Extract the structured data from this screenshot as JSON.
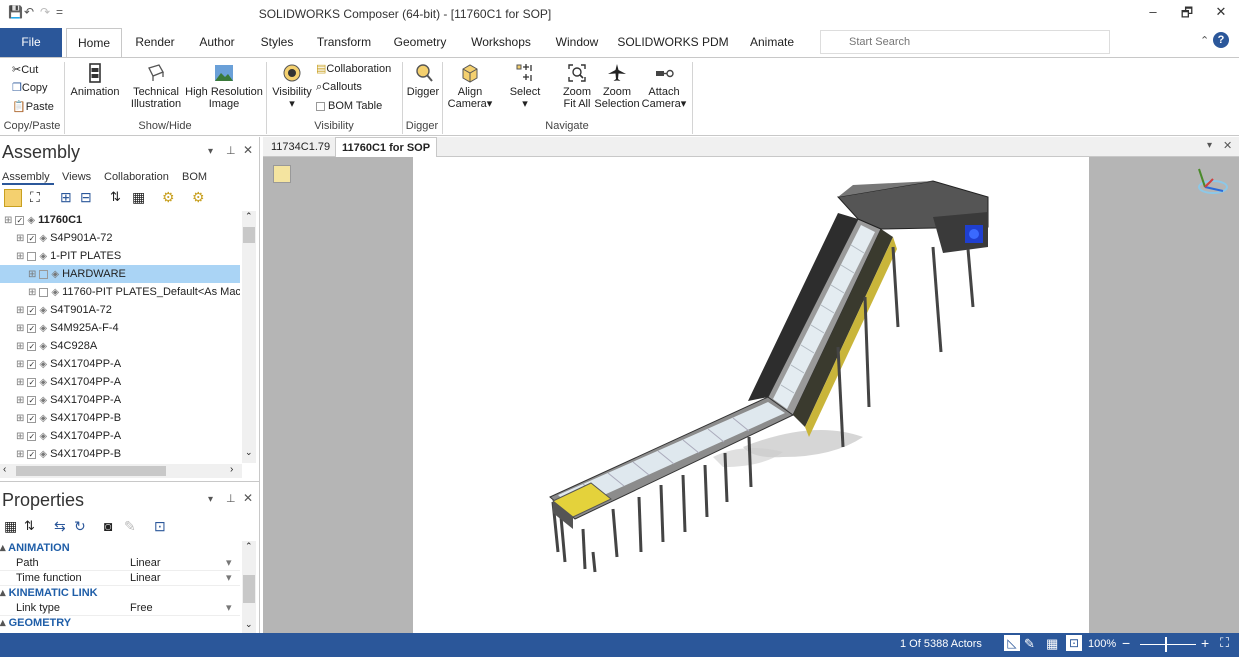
{
  "window": {
    "title": "SOLIDWORKS Composer (64-bit) - [11760C1 for SOP]",
    "controls": {
      "minimize": "–",
      "restore": "🗗",
      "close": "✕"
    }
  },
  "quick_access": {
    "save": "💾",
    "undo": "↶",
    "redo": "↷",
    "customize": "="
  },
  "tabs": {
    "file": "File",
    "items": [
      "Home",
      "Render",
      "Author",
      "Styles",
      "Transform",
      "Geometry",
      "Workshops",
      "Window",
      "SOLIDWORKS PDM",
      "Animate"
    ],
    "active": "Home"
  },
  "search": {
    "placeholder": "Start Search"
  },
  "ribbon": {
    "clipboard": {
      "cut": "Cut",
      "copy": "Copy",
      "paste": "Paste",
      "group": "Copy/Paste"
    },
    "showhide": {
      "animation": "Animation",
      "technical1": "Technical",
      "technical2": "Illustration",
      "hires1": "High Resolution",
      "hires2": "Image",
      "group": "Show/Hide"
    },
    "visibility": {
      "visibility": "Visibility",
      "collaboration": "Collaboration",
      "callouts": "Callouts",
      "bom_table": "BOM Table",
      "group": "Visibility"
    },
    "digger": {
      "digger": "Digger",
      "group": "Digger"
    },
    "navigate": {
      "align1": "Align",
      "align2": "Camera▾",
      "select": "Select",
      "zoomfit1": "Zoom",
      "zoomfit2": "Fit All",
      "zoomsel1": "Zoom",
      "zoomsel2": "Selection",
      "attach1": "Attach",
      "attach2": "Camera▾",
      "group": "Navigate"
    }
  },
  "assembly_panel": {
    "title": "Assembly",
    "subtabs": [
      "Assembly",
      "Views",
      "Collaboration",
      "BOM"
    ],
    "tree": [
      {
        "label": "11760C1",
        "bold": true,
        "indent": 0,
        "checked": true,
        "selected": false
      },
      {
        "label": "S4P901A-72",
        "indent": 1,
        "checked": true,
        "selected": false
      },
      {
        "label": "1-PIT PLATES",
        "indent": 1,
        "checked": false,
        "selected": false
      },
      {
        "label": "HARDWARE",
        "indent": 2,
        "checked": false,
        "selected": true
      },
      {
        "label": "11760-PIT PLATES_Default<As Mac",
        "indent": 2,
        "checked": false,
        "selected": false
      },
      {
        "label": "S4T901A-72",
        "indent": 1,
        "checked": true,
        "selected": false
      },
      {
        "label": "S4M925A-F-4",
        "indent": 1,
        "checked": true,
        "selected": false
      },
      {
        "label": "S4C928A",
        "indent": 1,
        "checked": true,
        "selected": false
      },
      {
        "label": "S4X1704PP-A",
        "indent": 1,
        "checked": true,
        "selected": false
      },
      {
        "label": "S4X1704PP-A",
        "indent": 1,
        "checked": true,
        "selected": false
      },
      {
        "label": "S4X1704PP-A",
        "indent": 1,
        "checked": true,
        "selected": false
      },
      {
        "label": "S4X1704PP-B",
        "indent": 1,
        "checked": true,
        "selected": false
      },
      {
        "label": "S4X1704PP-A",
        "indent": 1,
        "checked": true,
        "selected": false
      },
      {
        "label": "S4X1704PP-B",
        "indent": 1,
        "checked": true,
        "selected": false
      }
    ]
  },
  "properties_panel": {
    "title": "Properties",
    "sections": [
      {
        "name": "ANIMATION",
        "rows": [
          {
            "key": "Path",
            "value": "Linear"
          },
          {
            "key": "Time function",
            "value": "Linear"
          }
        ]
      },
      {
        "name": "KINEMATIC LINK",
        "rows": [
          {
            "key": "Link type",
            "value": "Free"
          }
        ]
      },
      {
        "name": "GEOMETRY",
        "rows": []
      }
    ]
  },
  "document_tabs": [
    "11734C1.79",
    "11760C1 for SOP"
  ],
  "status": {
    "actors": "1 Of 5388 Actors",
    "zoom": "100%"
  },
  "colors": {
    "accent": "#2b579a",
    "selection": "#aad4f5",
    "section_header": "#1f5ea8"
  }
}
